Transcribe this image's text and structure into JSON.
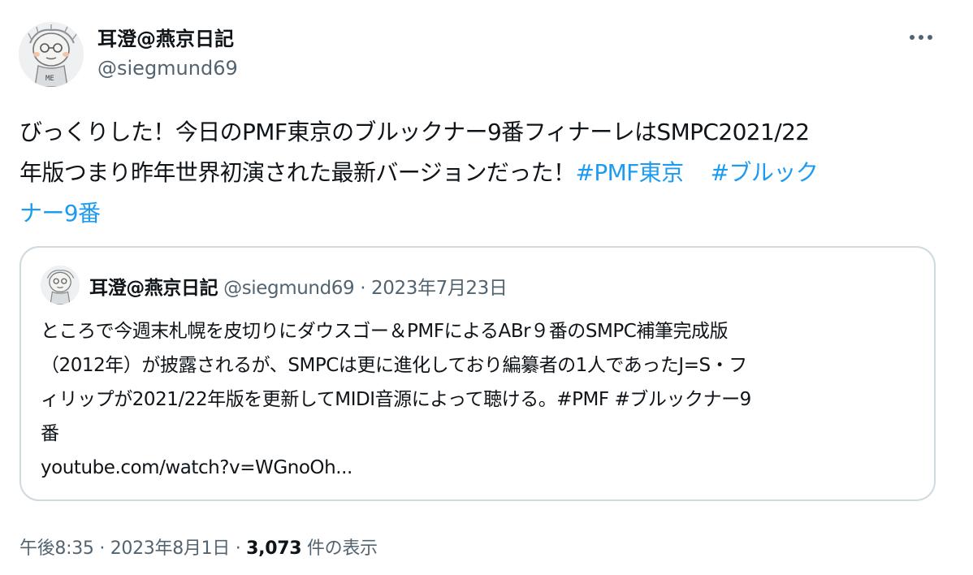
{
  "author": {
    "display_name": "耳澄@燕京日記",
    "handle": "@siegmund69"
  },
  "tweet": {
    "lines": [
      "びっくりした！今日のPMF東京のブルックナー9番フィナーレはSMPC2021/22",
      "年版つまり昨年世界初演された最新バージョンだった！"
    ],
    "hashtag_1": "#PMF東京",
    "hashtag_2_part1": "#ブルック",
    "hashtag_2_part2": "ナー9番"
  },
  "quote": {
    "display_name": "耳澄@燕京日記",
    "handle": "@siegmund69",
    "separator": "·",
    "date": "2023年7月23日",
    "lines": [
      "ところで今週末札幌を皮切りにダウスゴー＆PMFによるABr９番のSMPC補筆完成版",
      "（2012年）が披露されるが、SMPCは更に進化しており編纂者の1人であったJ=S・フ",
      "ィリップが2021/22年版を更新してMIDI音源によって聴ける。#PMF #ブルックナー9",
      "番",
      "youtube.com/watch?v=WGnoOh..."
    ]
  },
  "footer": {
    "time": "午後8:35",
    "separator": "·",
    "date": "2023年8月1日",
    "views_count": "3,073",
    "views_label": "件の表示"
  },
  "icons": {
    "more": "more-horizontal-icon",
    "avatar": "avatar-sketch"
  },
  "colors": {
    "link": "#1d9bf0",
    "secondary": "#536471",
    "text": "#0f1419",
    "border": "#cfd9de"
  }
}
